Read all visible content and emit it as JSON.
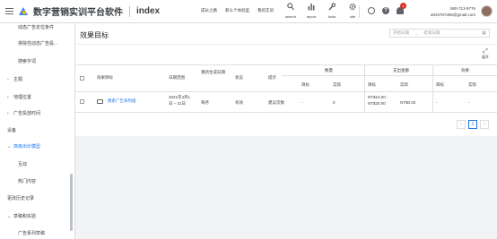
{
  "header": {
    "app_title": "数字营销实训平台软件",
    "page_name": "index",
    "links": [
      "成长之路",
      "新么个体验里",
      "我的实训"
    ],
    "tools": [
      {
        "label": "search",
        "icon": "search-icon"
      },
      {
        "label": "report",
        "icon": "bar-chart-icon"
      },
      {
        "label": "tools",
        "icon": "wrench-icon"
      },
      {
        "label": "site",
        "icon": "gear-icon"
      }
    ],
    "notification_count": "1",
    "account_line1": "980-713-9776",
    "account_line2": "a943787356@gmail.com"
  },
  "sidebar": {
    "items": [
      {
        "label": "动态广告定位条件",
        "kind": "sub"
      },
      {
        "label": "排除性动态广告投...",
        "kind": "sub"
      },
      {
        "label": "搜索字词",
        "kind": "sub"
      },
      {
        "label": "主题",
        "kind": "group"
      },
      {
        "label": "地理位置",
        "kind": "group"
      },
      {
        "label": "广告投放时间",
        "kind": "group"
      },
      {
        "label": "设备",
        "kind": "top"
      },
      {
        "label": "高级出价模型",
        "kind": "group-active"
      },
      {
        "label": "互动",
        "kind": "sub"
      },
      {
        "label": "热门内容",
        "kind": "sub"
      },
      {
        "label": "更改历史记录",
        "kind": "top"
      },
      {
        "label": "草稿和实验",
        "kind": "group"
      },
      {
        "label": "广告系列草稿",
        "kind": "sub"
      }
    ]
  },
  "main": {
    "title": "效果目标",
    "date_start_placeholder": "开始日期",
    "date_end_placeholder": "结束日期",
    "date_arrow": "→",
    "expand_label": "展开",
    "table": {
      "headers": {
        "goal": "效果目标",
        "date_range": "日期范围",
        "repeat_cycle": "重新生成日期",
        "status": "状态",
        "tip": "提示",
        "group_count": "数量",
        "group_spend": "支出金额",
        "group_effect": "效果",
        "target": "目标",
        "actual": "实际"
      },
      "rows": [
        {
          "goal": "携系广告系列组",
          "date_range_1": "2021年3月1",
          "date_range_2": "日 – 31日",
          "repeat_cycle": "每月",
          "status": "有效",
          "tip": "建议次数",
          "count_target": "-",
          "count_actual": "0",
          "spend_target_1": "NT$10.00 -",
          "spend_target_2": "NT$20.00",
          "spend_actual": "NT$0.00",
          "effect_target": "-",
          "effect_actual": "-"
        }
      ]
    },
    "pager": {
      "prev": "‹",
      "current": "1",
      "next": "›"
    }
  }
}
